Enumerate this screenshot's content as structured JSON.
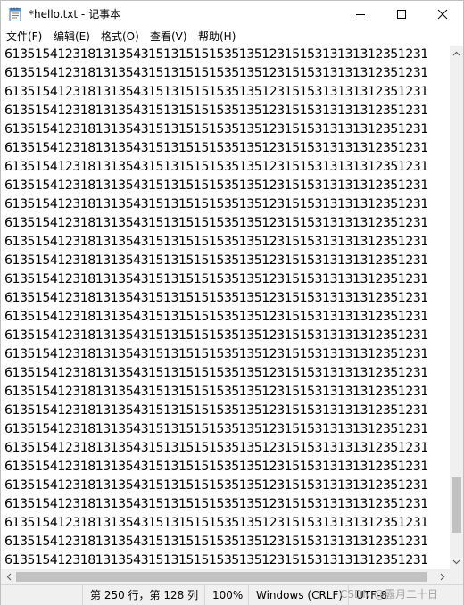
{
  "window": {
    "title": "*hello.txt - 记事本",
    "app_icon": "notepad-icon"
  },
  "controls": {
    "minimize_icon": "minimize-icon",
    "maximize_icon": "maximize-icon",
    "close_icon": "close-icon"
  },
  "menu": [
    {
      "label": "文件(F)"
    },
    {
      "label": "编辑(E)"
    },
    {
      "label": "格式(O)"
    },
    {
      "label": "查看(V)"
    },
    {
      "label": "帮助(H)"
    }
  ],
  "editor": {
    "line_text": "61351541231813135431513151515351351231515313131312351231"
  },
  "status": {
    "position": "第 250 行，第 128 列",
    "zoom": "100%",
    "line_ending": "Windows (CRLF)",
    "encoding": "UTF-8"
  },
  "watermark": "CSDN @露月二十日",
  "colors": {
    "status_bg": "#f0f0f0",
    "scroll_thumb": "#c1c1c1"
  }
}
